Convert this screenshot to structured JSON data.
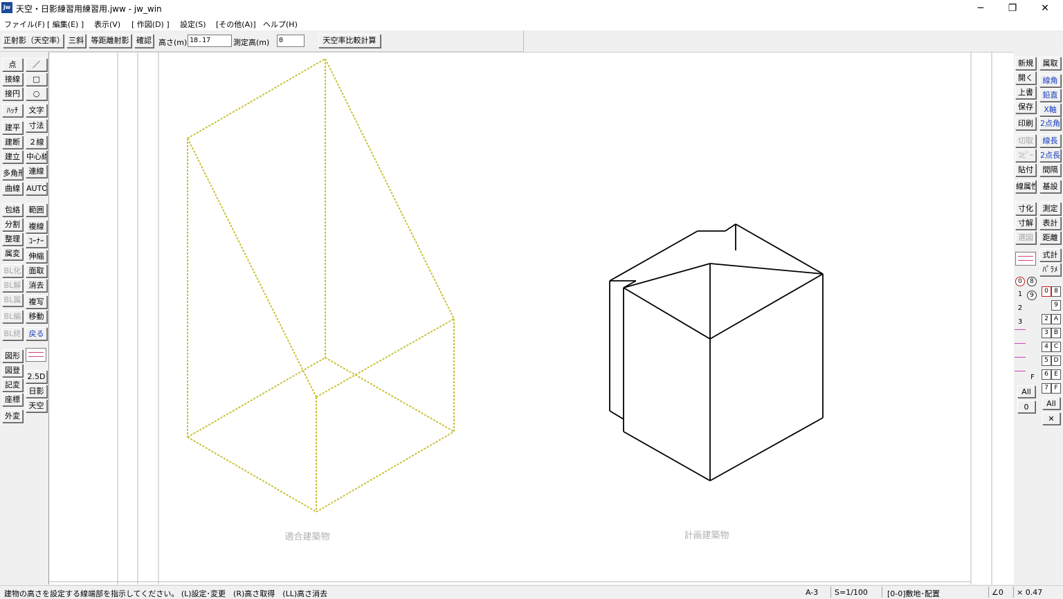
{
  "window": {
    "icon_text": "Jw",
    "title": "天空・日影練習用練習用.jww - jw_win",
    "controls": {
      "minimize": "─",
      "restore": "❐",
      "close": "✕"
    }
  },
  "menu": [
    "ファイル(F)",
    "[ 編集(E) ]",
    "表示(V)",
    "[ 作図(D) ]",
    "設定(S)",
    "[その他(A)]",
    "ヘルプ(H)"
  ],
  "toolbar": {
    "ortho_btn": "正射影（天空率）",
    "sankaku_btn": "三斜",
    "equidist_btn": "等距離射影",
    "confirm_btn": "確認",
    "height_label": "高さ(m)",
    "height_value": "18.17",
    "measure_label": "測定高(m)",
    "measure_value": "0",
    "compare_btn": "天空率比較計算"
  },
  "left_tools": {
    "col1": [
      "点",
      "接線",
      "接円",
      "ﾊｯﾁ",
      "建平",
      "建断",
      "建立",
      "多角形",
      "曲線",
      "包絡",
      "分割",
      "整理",
      "属変",
      "BL化",
      "BL解",
      "BL属",
      "BL編",
      "BL終",
      "図形",
      "図登",
      "記変",
      "座標",
      "外変"
    ],
    "col2": [
      "／",
      "□",
      "○",
      "文字",
      "寸法",
      "２線",
      "中心線",
      "連線",
      "AUTO",
      "範囲",
      "複線",
      "ｺｰﾅｰ",
      "伸縮",
      "面取",
      "消去",
      "複写",
      "移動",
      "戻る",
      "2.5D",
      "日影",
      "天空"
    ]
  },
  "right_tools": {
    "col1": [
      "新規",
      "開く",
      "上書",
      "保存",
      "印刷",
      "切取",
      "ｺﾋﾟｰ",
      "貼付",
      "線属性",
      "寸化",
      "寸解",
      "選図"
    ],
    "col2": [
      "属取",
      "線角",
      "鉛直",
      "X軸",
      "2点角",
      "線長",
      "2点長",
      "間隔",
      "基設",
      "測定",
      "表計",
      "距離",
      "式計",
      "ﾊﾟﾗﾒ"
    ]
  },
  "layers": {
    "group_circle_0": "0",
    "group_circle_8": "8",
    "group_circle_9": "9",
    "group_rows": [
      "1",
      "2",
      "3"
    ],
    "f_label": "F",
    "all_label": "All",
    "zero_label": "0",
    "right_buttons": [
      "0",
      "8",
      "9",
      "2",
      "A",
      "3",
      "B",
      "4",
      "C",
      "5",
      "D",
      "6",
      "E",
      "7",
      "F"
    ],
    "right_all": "All",
    "right_x": "✕"
  },
  "drawing": {
    "label_left": "適合建築物",
    "label_right": "計画建築物",
    "colors": {
      "compliant_lines": "#c8c030",
      "plan_lines": "#000000",
      "label": "#b0b0b0"
    }
  },
  "status": {
    "message": "建物の高さを設定する線端部を指示してください。 (L)設定･変更　(R)高さ取得　(LL)高さ消去",
    "paper": "A-3",
    "scale": "S=1/100",
    "layer": "[0-0]敷地･配置",
    "angle": "∠0",
    "zoom": "× 0.47"
  }
}
